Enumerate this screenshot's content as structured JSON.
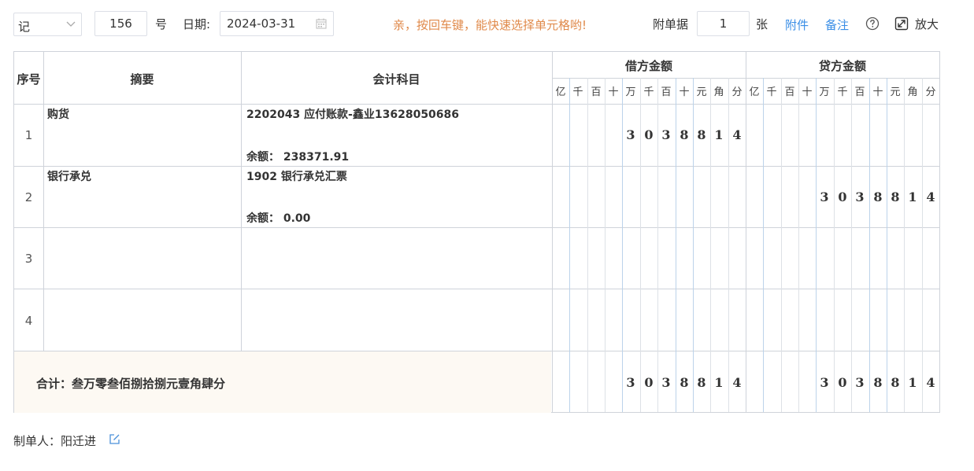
{
  "toolbar": {
    "voucher_type": "记",
    "voucher_no": "156",
    "no_suffix": "号",
    "date_label": "日期:",
    "date_value": "2024-03-31",
    "hint": "亲，按回车键，能快速选择单元格哟!",
    "attachments_label": "附单据",
    "attachments_count": "1",
    "attachments_unit": "张",
    "attachment_link": "附件",
    "note_link": "备注",
    "expand_label": "放大"
  },
  "table": {
    "headers": {
      "seq": "序号",
      "summary": "摘要",
      "subject": "会计科目",
      "debit": "借方金额",
      "credit": "贷方金额"
    },
    "digit_units": [
      "亿",
      "千",
      "百",
      "十",
      "万",
      "千",
      "百",
      "十",
      "元",
      "角",
      "分"
    ],
    "rows": [
      {
        "no": "1",
        "summary": "购货",
        "subject": "2202043 应付账款-鑫业13628050686",
        "balance": "余额： 238371.91",
        "debit_digits": [
          "",
          "",
          "",
          "",
          "3",
          "0",
          "3",
          "8",
          "8",
          "1",
          "4"
        ],
        "credit_digits": [
          "",
          "",
          "",
          "",
          "",
          "",
          "",
          "",
          "",
          "",
          ""
        ]
      },
      {
        "no": "2",
        "summary": "银行承兑",
        "subject": "1902 银行承兑汇票",
        "balance": "余额： 0.00",
        "debit_digits": [
          "",
          "",
          "",
          "",
          "",
          "",
          "",
          "",
          "",
          "",
          ""
        ],
        "credit_digits": [
          "",
          "",
          "",
          "",
          "3",
          "0",
          "3",
          "8",
          "8",
          "1",
          "4"
        ]
      },
      {
        "no": "3",
        "summary": "",
        "subject": "",
        "balance": "",
        "debit_digits": [
          "",
          "",
          "",
          "",
          "",
          "",
          "",
          "",
          "",
          "",
          ""
        ],
        "credit_digits": [
          "",
          "",
          "",
          "",
          "",
          "",
          "",
          "",
          "",
          "",
          ""
        ]
      },
      {
        "no": "4",
        "summary": "",
        "subject": "",
        "balance": "",
        "debit_digits": [
          "",
          "",
          "",
          "",
          "",
          "",
          "",
          "",
          "",
          "",
          ""
        ],
        "credit_digits": [
          "",
          "",
          "",
          "",
          "",
          "",
          "",
          "",
          "",
          "",
          ""
        ]
      }
    ],
    "total": {
      "label": "合计：叁万零叁佰捌拾捌元壹角肆分",
      "debit_digits": [
        "",
        "",
        "",
        "",
        "3",
        "0",
        "3",
        "8",
        "8",
        "1",
        "4"
      ],
      "credit_digits": [
        "",
        "",
        "",
        "",
        "3",
        "0",
        "3",
        "8",
        "8",
        "1",
        "4"
      ]
    }
  },
  "footer": {
    "creator_label": "制单人：阳迁进"
  }
}
